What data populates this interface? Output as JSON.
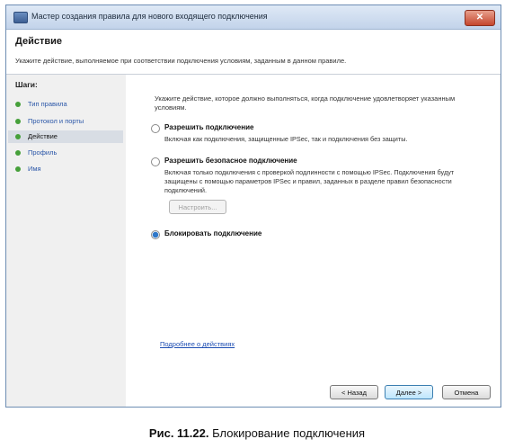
{
  "window": {
    "title": "Мастер создания правила для нового входящего подключения",
    "close_symbol": "✕"
  },
  "header": {
    "title": "Действие",
    "description": "Укажите действие, выполняемое при соответствии подключения условиям, заданным в данном правиле."
  },
  "steps": {
    "title": "Шаги:",
    "items": [
      {
        "label": "Тип правила",
        "active": false
      },
      {
        "label": "Протокол и порты",
        "active": false
      },
      {
        "label": "Действие",
        "active": true
      },
      {
        "label": "Профиль",
        "active": false
      },
      {
        "label": "Имя",
        "active": false
      }
    ]
  },
  "content": {
    "intro": "Укажите действие, которое должно выполняться, когда подключение удовлетворяет указанным условиям.",
    "options": [
      {
        "title": "Разрешить подключение",
        "desc": "Включая как подключения, защищенные IPSec, так и подключения без защиты.",
        "selected": false
      },
      {
        "title": "Разрешить безопасное подключение",
        "desc": "Включая только подключения с проверкой подлинности с помощью IPSec. Подключения будут защищены с помощью параметров IPSec и правил, заданных в разделе правил безопасности подключений.",
        "selected": false
      },
      {
        "title": "Блокировать подключение",
        "desc": "",
        "selected": true
      }
    ],
    "customize_button": "Настроить...",
    "link": "Подробнее о действиях"
  },
  "footer": {
    "back": "< Назад",
    "next": "Далее >",
    "cancel": "Отмена"
  },
  "caption": {
    "prefix": "Рис. 11.22.",
    "text": "Блокирование подключения"
  }
}
